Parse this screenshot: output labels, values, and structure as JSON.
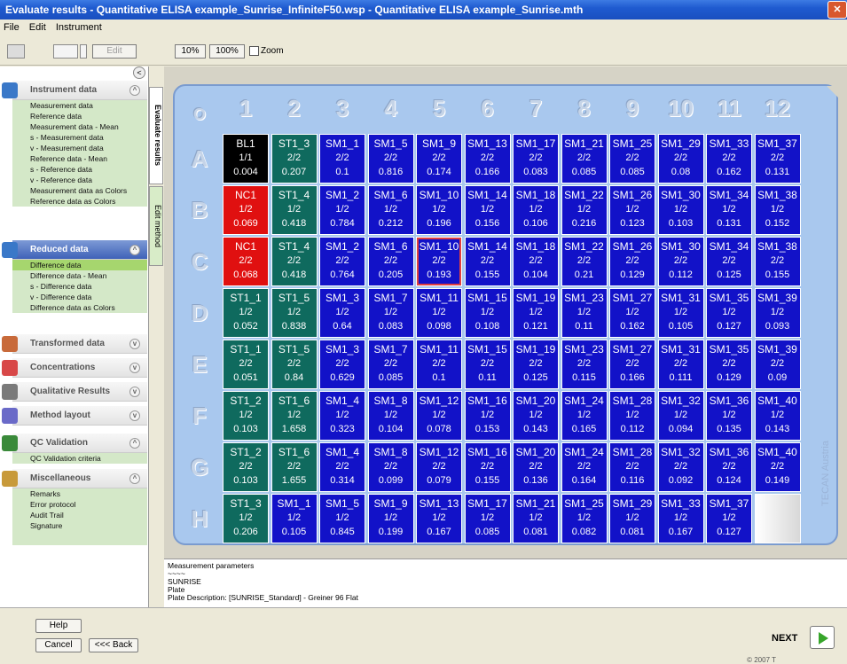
{
  "window": {
    "title": "Evaluate results - Quantitative ELISA example_Sunrise_InfiniteF50.wsp - Quantitative ELISA example_Sunrise.mth",
    "close_label": "✕"
  },
  "menu": [
    "File",
    "Edit",
    "Instrument"
  ],
  "toolbar": {
    "edit_label": "Edit",
    "zoom10": "10%",
    "zoom100": "100%",
    "zoom_label": "Zoom"
  },
  "sidebar": {
    "groups": [
      {
        "title": "Instrument data",
        "icon_color": "#3a78c8",
        "items": [
          "Measurement data",
          "Reference data",
          "Measurement data - Mean",
          "s - Measurement data",
          "v - Measurement data",
          "Reference data - Mean",
          "s - Reference data",
          "v - Reference data",
          "Measurement data as Colors",
          "Reference data as Colors"
        ]
      },
      {
        "title": "Reduced data",
        "icon_color": "#3a78c8",
        "items": [
          "Difference data",
          "Difference data - Mean",
          "s - Difference data",
          "v - Difference data",
          "Difference data as Colors"
        ]
      },
      {
        "title": "Transformed data",
        "icon_color": "#c86a3a",
        "items": []
      },
      {
        "title": "Concentrations",
        "icon_color": "#d84848",
        "items": []
      },
      {
        "title": "Qualitative Results",
        "icon_color": "#7a7a7a",
        "items": []
      },
      {
        "title": "Method layout",
        "icon_color": "#6a6ac8",
        "items": []
      },
      {
        "title": "QC Validation",
        "icon_color": "#3a8a3a",
        "items": [
          "QC Validation criteria"
        ]
      },
      {
        "title": "Miscellaneous",
        "icon_color": "#c89a3a",
        "items": [
          "Remarks",
          "Error protocol",
          "Audit Trail",
          "Signature"
        ]
      }
    ]
  },
  "tabs": {
    "evaluate": "Evaluate results",
    "edit_method": "Edit method"
  },
  "plate": {
    "corner": "O",
    "columns": [
      "1",
      "2",
      "3",
      "4",
      "5",
      "6",
      "7",
      "8",
      "9",
      "10",
      "11",
      "12"
    ],
    "rows": [
      "A",
      "B",
      "C",
      "D",
      "E",
      "F",
      "G",
      "H"
    ],
    "brand": "TECAN Austria",
    "colors": {
      "black": "#000000",
      "red": "#e01010",
      "teal": "#0f6a5e",
      "blue": "#1212c8",
      "empty": "#f0f0f0"
    },
    "wells": [
      [
        [
          "BL1",
          "1/1",
          "0.004",
          "black"
        ],
        [
          "ST1_3",
          "2/2",
          "0.207",
          "teal"
        ],
        [
          "SM1_1",
          "2/2",
          "0.1",
          "blue"
        ],
        [
          "SM1_5",
          "2/2",
          "0.816",
          "blue"
        ],
        [
          "SM1_9",
          "2/2",
          "0.174",
          "blue"
        ],
        [
          "SM1_13",
          "2/2",
          "0.166",
          "blue"
        ],
        [
          "SM1_17",
          "2/2",
          "0.083",
          "blue"
        ],
        [
          "SM1_21",
          "2/2",
          "0.085",
          "blue"
        ],
        [
          "SM1_25",
          "2/2",
          "0.085",
          "blue"
        ],
        [
          "SM1_29",
          "2/2",
          "0.08",
          "blue"
        ],
        [
          "SM1_33",
          "2/2",
          "0.162",
          "blue"
        ],
        [
          "SM1_37",
          "2/2",
          "0.131",
          "blue"
        ]
      ],
      [
        [
          "NC1",
          "1/2",
          "0.069",
          "red"
        ],
        [
          "ST1_4",
          "1/2",
          "0.418",
          "teal"
        ],
        [
          "SM1_2",
          "1/2",
          "0.784",
          "blue"
        ],
        [
          "SM1_6",
          "1/2",
          "0.212",
          "blue"
        ],
        [
          "SM1_10",
          "1/2",
          "0.196",
          "blue"
        ],
        [
          "SM1_14",
          "1/2",
          "0.156",
          "blue"
        ],
        [
          "SM1_18",
          "1/2",
          "0.106",
          "blue"
        ],
        [
          "SM1_22",
          "1/2",
          "0.216",
          "blue"
        ],
        [
          "SM1_26",
          "1/2",
          "0.123",
          "blue"
        ],
        [
          "SM1_30",
          "1/2",
          "0.103",
          "blue"
        ],
        [
          "SM1_34",
          "1/2",
          "0.131",
          "blue"
        ],
        [
          "SM1_38",
          "1/2",
          "0.152",
          "blue"
        ]
      ],
      [
        [
          "NC1",
          "2/2",
          "0.068",
          "red"
        ],
        [
          "ST1_4",
          "2/2",
          "0.418",
          "teal"
        ],
        [
          "SM1_2",
          "2/2",
          "0.764",
          "blue"
        ],
        [
          "SM1_6",
          "2/2",
          "0.205",
          "blue"
        ],
        [
          "SM1_10",
          "2/2",
          "0.193",
          "blue"
        ],
        [
          "SM1_14",
          "2/2",
          "0.155",
          "blue"
        ],
        [
          "SM1_18",
          "2/2",
          "0.104",
          "blue"
        ],
        [
          "SM1_22",
          "2/2",
          "0.21",
          "blue"
        ],
        [
          "SM1_26",
          "2/2",
          "0.129",
          "blue"
        ],
        [
          "SM1_30",
          "2/2",
          "0.112",
          "blue"
        ],
        [
          "SM1_34",
          "2/2",
          "0.125",
          "blue"
        ],
        [
          "SM1_38",
          "2/2",
          "0.155",
          "blue"
        ]
      ],
      [
        [
          "ST1_1",
          "1/2",
          "0.052",
          "teal"
        ],
        [
          "ST1_5",
          "1/2",
          "0.838",
          "teal"
        ],
        [
          "SM1_3",
          "1/2",
          "0.64",
          "blue"
        ],
        [
          "SM1_7",
          "1/2",
          "0.083",
          "blue"
        ],
        [
          "SM1_11",
          "1/2",
          "0.098",
          "blue"
        ],
        [
          "SM1_15",
          "1/2",
          "0.108",
          "blue"
        ],
        [
          "SM1_19",
          "1/2",
          "0.121",
          "blue"
        ],
        [
          "SM1_23",
          "1/2",
          "0.11",
          "blue"
        ],
        [
          "SM1_27",
          "1/2",
          "0.162",
          "blue"
        ],
        [
          "SM1_31",
          "1/2",
          "0.105",
          "blue"
        ],
        [
          "SM1_35",
          "1/2",
          "0.127",
          "blue"
        ],
        [
          "SM1_39",
          "1/2",
          "0.093",
          "blue"
        ]
      ],
      [
        [
          "ST1_1",
          "2/2",
          "0.051",
          "teal"
        ],
        [
          "ST1_5",
          "2/2",
          "0.84",
          "teal"
        ],
        [
          "SM1_3",
          "2/2",
          "0.629",
          "blue"
        ],
        [
          "SM1_7",
          "2/2",
          "0.085",
          "blue"
        ],
        [
          "SM1_11",
          "2/2",
          "0.1",
          "blue"
        ],
        [
          "SM1_15",
          "2/2",
          "0.11",
          "blue"
        ],
        [
          "SM1_19",
          "2/2",
          "0.125",
          "blue"
        ],
        [
          "SM1_23",
          "2/2",
          "0.115",
          "blue"
        ],
        [
          "SM1_27",
          "2/2",
          "0.166",
          "blue"
        ],
        [
          "SM1_31",
          "2/2",
          "0.111",
          "blue"
        ],
        [
          "SM1_35",
          "2/2",
          "0.129",
          "blue"
        ],
        [
          "SM1_39",
          "2/2",
          "0.09",
          "blue"
        ]
      ],
      [
        [
          "ST1_2",
          "1/2",
          "0.103",
          "teal"
        ],
        [
          "ST1_6",
          "1/2",
          "1.658",
          "teal"
        ],
        [
          "SM1_4",
          "1/2",
          "0.323",
          "blue"
        ],
        [
          "SM1_8",
          "1/2",
          "0.104",
          "blue"
        ],
        [
          "SM1_12",
          "1/2",
          "0.078",
          "blue"
        ],
        [
          "SM1_16",
          "1/2",
          "0.153",
          "blue"
        ],
        [
          "SM1_20",
          "1/2",
          "0.143",
          "blue"
        ],
        [
          "SM1_24",
          "1/2",
          "0.165",
          "blue"
        ],
        [
          "SM1_28",
          "1/2",
          "0.112",
          "blue"
        ],
        [
          "SM1_32",
          "1/2",
          "0.094",
          "blue"
        ],
        [
          "SM1_36",
          "1/2",
          "0.135",
          "blue"
        ],
        [
          "SM1_40",
          "1/2",
          "0.143",
          "blue"
        ]
      ],
      [
        [
          "ST1_2",
          "2/2",
          "0.103",
          "teal"
        ],
        [
          "ST1_6",
          "2/2",
          "1.655",
          "teal"
        ],
        [
          "SM1_4",
          "2/2",
          "0.314",
          "blue"
        ],
        [
          "SM1_8",
          "2/2",
          "0.099",
          "blue"
        ],
        [
          "SM1_12",
          "2/2",
          "0.079",
          "blue"
        ],
        [
          "SM1_16",
          "2/2",
          "0.155",
          "blue"
        ],
        [
          "SM1_20",
          "2/2",
          "0.136",
          "blue"
        ],
        [
          "SM1_24",
          "2/2",
          "0.164",
          "blue"
        ],
        [
          "SM1_28",
          "2/2",
          "0.116",
          "blue"
        ],
        [
          "SM1_32",
          "2/2",
          "0.092",
          "blue"
        ],
        [
          "SM1_36",
          "2/2",
          "0.124",
          "blue"
        ],
        [
          "SM1_40",
          "2/2",
          "0.149",
          "blue"
        ]
      ],
      [
        [
          "ST1_3",
          "1/2",
          "0.206",
          "teal"
        ],
        [
          "SM1_1",
          "1/2",
          "0.105",
          "blue"
        ],
        [
          "SM1_5",
          "1/2",
          "0.845",
          "blue"
        ],
        [
          "SM1_9",
          "1/2",
          "0.199",
          "blue"
        ],
        [
          "SM1_13",
          "1/2",
          "0.167",
          "blue"
        ],
        [
          "SM1_17",
          "1/2",
          "0.085",
          "blue"
        ],
        [
          "SM1_21",
          "1/2",
          "0.081",
          "blue"
        ],
        [
          "SM1_25",
          "1/2",
          "0.082",
          "blue"
        ],
        [
          "SM1_29",
          "1/2",
          "0.081",
          "blue"
        ],
        [
          "SM1_33",
          "1/2",
          "0.167",
          "blue"
        ],
        [
          "SM1_37",
          "1/2",
          "0.127",
          "blue"
        ],
        [
          "",
          "",
          "",
          "empty"
        ]
      ]
    ],
    "selected": [
      2,
      4
    ]
  },
  "params": [
    "Measurement parameters",
    "~~~~",
    "SUNRISE",
    "Plate",
    "Plate Description: [SUNRISE_Standard] - Greiner 96 Flat"
  ],
  "bottom": {
    "help": "Help",
    "cancel": "Cancel",
    "back": "<<< Back",
    "next": "NEXT",
    "copyright": "© 2007 T"
  }
}
